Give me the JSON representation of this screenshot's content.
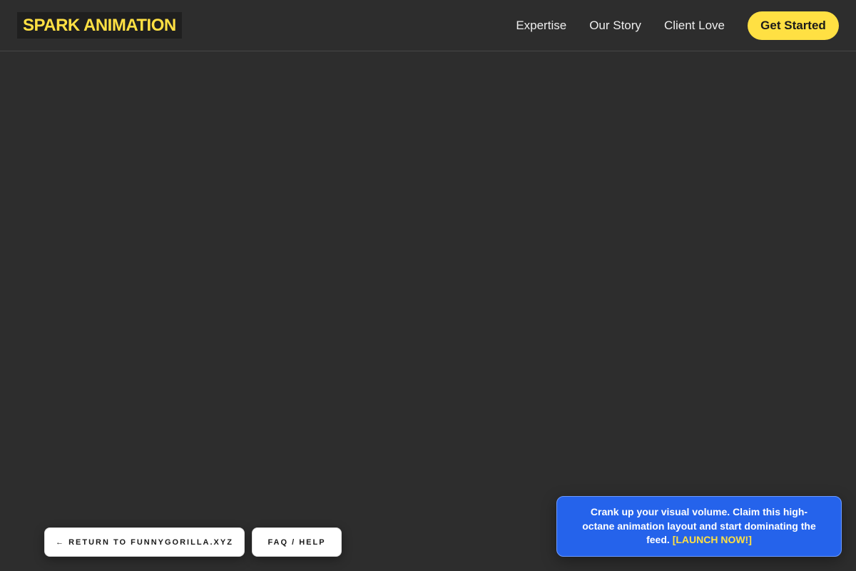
{
  "header": {
    "logo": "SPARK ANIMATION",
    "nav": [
      {
        "label": "Expertise"
      },
      {
        "label": "Our Story"
      },
      {
        "label": "Client Love"
      }
    ],
    "cta_label": "Get Started"
  },
  "footer_buttons": {
    "return_label": "← RETURN TO FUNNYGORILLA.XYZ",
    "faq_label": "FAQ / HELP"
  },
  "promo": {
    "text": "Crank up your visual volume. Claim this high-octane animation layout and start dominating the feed.",
    "link_label": "[LAUNCH NOW!]"
  },
  "colors": {
    "background": "#2d2d2d",
    "accent": "#ffe043",
    "promo_blue": "#2563eb"
  }
}
